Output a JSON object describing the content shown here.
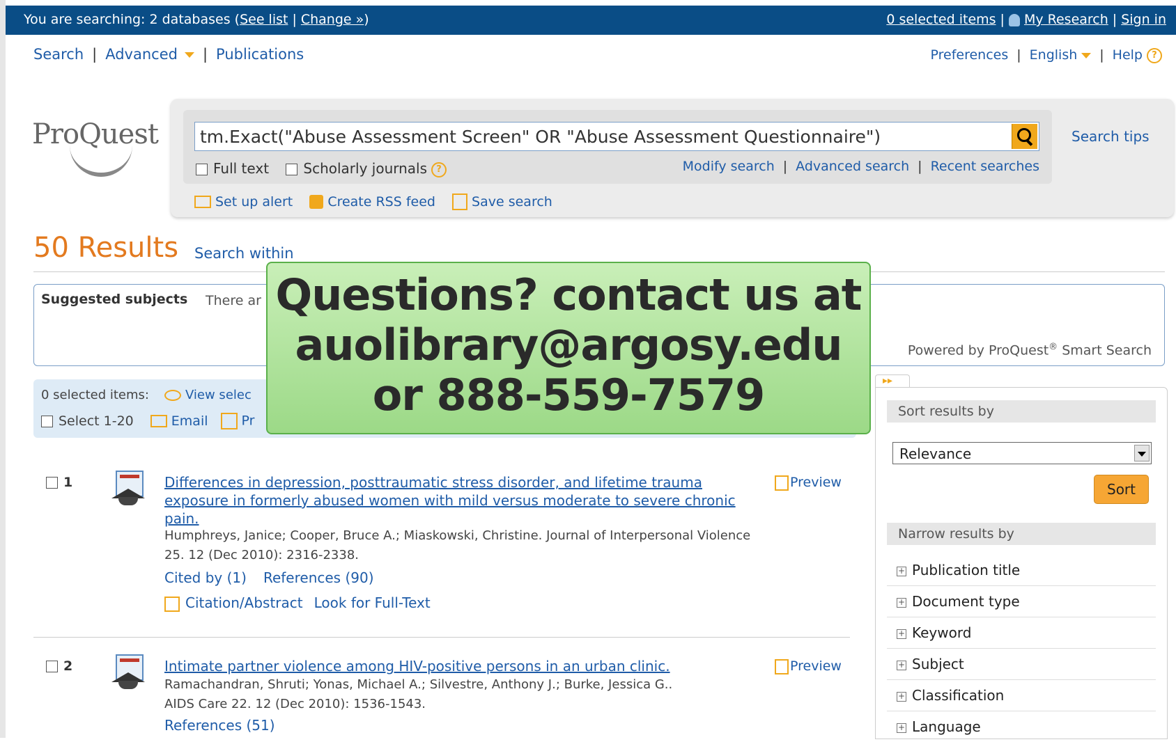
{
  "topbar": {
    "searching_prefix": "You are searching: 2 databases (",
    "see_list": "See list",
    "change": "Change »",
    "searching_suffix": ")",
    "selected_items": "0 selected items",
    "my_research": "My Research",
    "sign_in": "Sign in"
  },
  "nav": {
    "search": "Search",
    "advanced": "Advanced",
    "publications": "Publications",
    "preferences": "Preferences",
    "language": "English",
    "help": "Help",
    "help_icon": "?"
  },
  "logo": {
    "text": "ProQuest"
  },
  "search": {
    "query": "tm.Exact(\"Abuse Assessment Screen\" OR \"Abuse Assessment Questionnaire\")",
    "full_text": "Full text",
    "scholarly": "Scholarly journals",
    "modify": "Modify search",
    "advanced": "Advanced search",
    "recent": "Recent searches",
    "tips": "Search tips",
    "alert": "Set up alert",
    "rss": "Create RSS feed",
    "save": "Save search"
  },
  "results": {
    "count": "50 Results",
    "search_within": "Search within"
  },
  "subjects": {
    "label": "Suggested subjects",
    "text": "There ar",
    "powered": "Powered by ProQuest",
    "powered_mark": "®",
    "powered_suffix": " Smart Search"
  },
  "selection": {
    "selected": "0 selected items:",
    "view": "View selec",
    "select_range": "Select 1-20",
    "email": "Email",
    "print": "Pr"
  },
  "overlay": {
    "line1": "Questions? contact us at",
    "line2": "auolibrary@argosy.edu",
    "line3": "or 888-559-7579"
  },
  "items": [
    {
      "num": "1",
      "title": "Differences in depression, posttraumatic stress disorder, and lifetime trauma exposure in formerly abused women with mild versus moderate to severe chronic pain.",
      "preview": "Preview",
      "authors": "Humphreys, Janice; Cooper, Bruce A.; Miaskowski, Christine. Journal of Interpersonal Violence",
      "source": "25. 12  (Dec 2010): 2316-2338.",
      "cited_by": "Cited by (1)",
      "references": "References (90)",
      "citation": "Citation/Abstract",
      "full_text": "Look for Full-Text"
    },
    {
      "num": "2",
      "title": "Intimate partner violence among HIV-positive persons in an urban clinic.",
      "preview": "Preview",
      "authors": "Ramachandran, Shruti; Yonas, Michael A.; Silvestre, Anthony J.; Burke, Jessica G..",
      "source": "AIDS Care 22. 12  (Dec 2010): 1536-1543.",
      "references": "References (51)"
    }
  ],
  "sidebar": {
    "tab": "▸▸",
    "sort_header": "Sort results by",
    "sort_value": "Relevance",
    "sort_button": "Sort",
    "narrow_header": "Narrow results by",
    "facets": [
      "Publication title",
      "Document type",
      "Keyword",
      "Subject",
      "Classification",
      "Language"
    ]
  }
}
